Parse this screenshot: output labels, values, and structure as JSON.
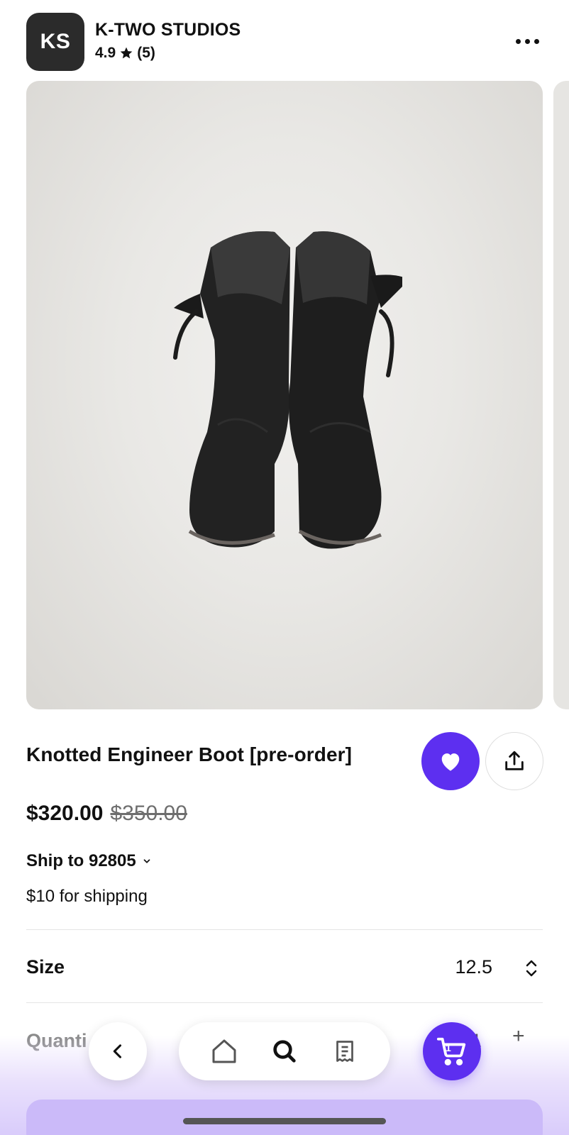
{
  "shop": {
    "initials": "KS",
    "name": "K-TWO STUDIOS",
    "rating": "4.9",
    "review_count": "(5)"
  },
  "product": {
    "title": "Knotted Engineer Boot [pre-order]",
    "price": "$320.00",
    "original_price": "$350.00",
    "ship_to": "Ship to 92805",
    "shipping_cost": "$10 for shipping"
  },
  "options": {
    "size_label": "Size",
    "size_value": "12.5",
    "quantity_label": "Quanti",
    "quantity_value": "1",
    "quantity_plus": "+"
  },
  "nav": {
    "cart_count": "1"
  },
  "colors": {
    "accent": "#5d2ff0",
    "accent_light": "#cbbaf9"
  }
}
